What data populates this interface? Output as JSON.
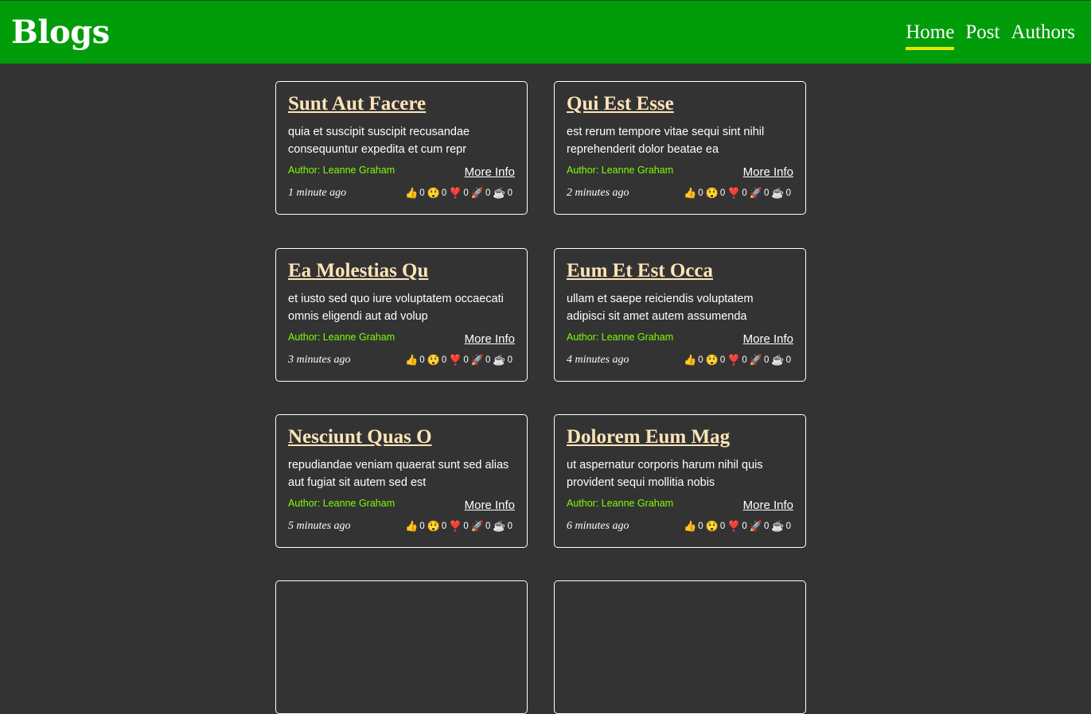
{
  "header": {
    "brand": "Blogs",
    "nav": [
      {
        "label": "Home",
        "active": true
      },
      {
        "label": "Post",
        "active": false
      },
      {
        "label": "Authors",
        "active": false
      }
    ]
  },
  "reaction_icons": [
    "👍",
    "😲",
    "❣️",
    "🚀",
    "☕"
  ],
  "posts": [
    {
      "title": "Sunt Aut Facere",
      "excerpt": "quia et suscipit suscipit recusandae consequuntur expedita et cum repr",
      "author": "Author: Leanne Graham",
      "more": "More Info",
      "time": "1 minute ago",
      "reactions": [
        0,
        0,
        0,
        0,
        0
      ]
    },
    {
      "title": "Qui Est Esse",
      "excerpt": "est rerum tempore vitae sequi sint nihil reprehenderit dolor beatae ea",
      "author": "Author: Leanne Graham",
      "more": "More Info",
      "time": "2 minutes ago",
      "reactions": [
        0,
        0,
        0,
        0,
        0
      ]
    },
    {
      "title": "Ea Molestias Qu",
      "excerpt": "et iusto sed quo iure voluptatem occaecati omnis eligendi aut ad volup",
      "author": "Author: Leanne Graham",
      "more": "More Info",
      "time": "3 minutes ago",
      "reactions": [
        0,
        0,
        0,
        0,
        0
      ]
    },
    {
      "title": "Eum Et Est Occa",
      "excerpt": "ullam et saepe reiciendis voluptatem adipisci sit amet autem assumenda",
      "author": "Author: Leanne Graham",
      "more": "More Info",
      "time": "4 minutes ago",
      "reactions": [
        0,
        0,
        0,
        0,
        0
      ]
    },
    {
      "title": "Nesciunt Quas O",
      "excerpt": "repudiandae veniam quaerat sunt sed alias aut fugiat sit autem sed est",
      "author": "Author: Leanne Graham",
      "more": "More Info",
      "time": "5 minutes ago",
      "reactions": [
        0,
        0,
        0,
        0,
        0
      ]
    },
    {
      "title": "Dolorem Eum Mag",
      "excerpt": "ut aspernatur corporis harum nihil quis provident sequi mollitia nobis",
      "author": "Author: Leanne Graham",
      "more": "More Info",
      "time": "6 minutes ago",
      "reactions": [
        0,
        0,
        0,
        0,
        0
      ]
    }
  ]
}
